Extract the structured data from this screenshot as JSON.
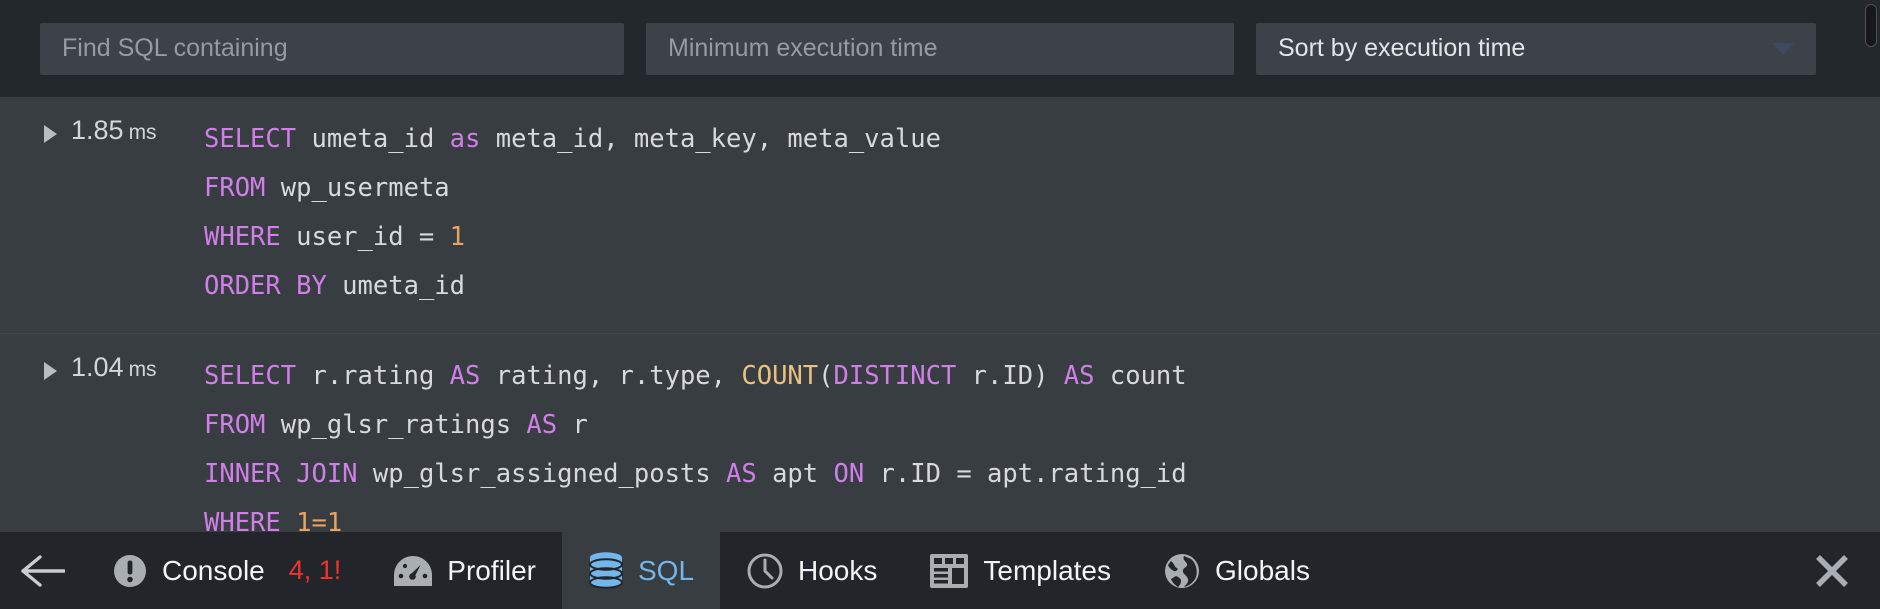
{
  "filters": {
    "find_placeholder": "Find SQL containing",
    "find_value": "",
    "min_time_placeholder": "Minimum execution time",
    "min_time_value": "",
    "sort_selected": "Sort by execution time",
    "sort_options": [
      "Sort by execution time"
    ]
  },
  "queries": [
    {
      "time": "1.85",
      "unit": "ms",
      "expanded": false,
      "lines": [
        [
          {
            "t": "SELECT",
            "c": "kw"
          },
          {
            "t": " umeta_id ",
            "c": "pl"
          },
          {
            "t": "as",
            "c": "kw"
          },
          {
            "t": " meta_id, meta_key, meta_value",
            "c": "pl"
          }
        ],
        [
          {
            "t": "FROM",
            "c": "kw"
          },
          {
            "t": " wp_usermeta",
            "c": "pl"
          }
        ],
        [
          {
            "t": "WHERE",
            "c": "kw"
          },
          {
            "t": " user_id = ",
            "c": "pl"
          },
          {
            "t": "1",
            "c": "num"
          }
        ],
        [
          {
            "t": "ORDER BY",
            "c": "kw"
          },
          {
            "t": " umeta_id",
            "c": "pl"
          }
        ]
      ]
    },
    {
      "time": "1.04",
      "unit": "ms",
      "expanded": false,
      "lines": [
        [
          {
            "t": "SELECT",
            "c": "kw"
          },
          {
            "t": " r.rating ",
            "c": "pl"
          },
          {
            "t": "AS",
            "c": "kw"
          },
          {
            "t": " rating, r.type, ",
            "c": "pl"
          },
          {
            "t": "COUNT",
            "c": "fn"
          },
          {
            "t": "(",
            "c": "pl"
          },
          {
            "t": "DISTINCT",
            "c": "kw"
          },
          {
            "t": " r.ID) ",
            "c": "pl"
          },
          {
            "t": "AS",
            "c": "kw"
          },
          {
            "t": " count",
            "c": "pl"
          }
        ],
        [
          {
            "t": "FROM",
            "c": "kw"
          },
          {
            "t": " wp_glsr_ratings ",
            "c": "pl"
          },
          {
            "t": "AS",
            "c": "kw"
          },
          {
            "t": " r",
            "c": "pl"
          }
        ],
        [
          {
            "t": "INNER JOIN",
            "c": "kw"
          },
          {
            "t": " wp_glsr_assigned_posts ",
            "c": "pl"
          },
          {
            "t": "AS",
            "c": "kw"
          },
          {
            "t": " apt ",
            "c": "pl"
          },
          {
            "t": "ON",
            "c": "kw"
          },
          {
            "t": " r.ID = apt.rating_id",
            "c": "pl"
          }
        ],
        [
          {
            "t": "WHERE",
            "c": "kw"
          },
          {
            "t": " ",
            "c": "pl"
          },
          {
            "t": "1=1",
            "c": "num"
          }
        ]
      ]
    }
  ],
  "toolbar": {
    "back_icon": "arrow-left-icon",
    "close_icon": "close-icon",
    "tabs": [
      {
        "id": "console",
        "label": "Console",
        "icon": "warning-icon",
        "badge": "4, 1!",
        "active": false
      },
      {
        "id": "profiler",
        "label": "Profiler",
        "icon": "gauge-icon",
        "badge": "",
        "active": false
      },
      {
        "id": "sql",
        "label": "SQL",
        "icon": "database-icon",
        "badge": "",
        "active": true
      },
      {
        "id": "hooks",
        "label": "Hooks",
        "icon": "clock-icon",
        "badge": "",
        "active": false
      },
      {
        "id": "templates",
        "label": "Templates",
        "icon": "template-icon",
        "badge": "",
        "active": false
      },
      {
        "id": "globals",
        "label": "Globals",
        "icon": "globe-icon",
        "badge": "",
        "active": false
      }
    ]
  },
  "colors": {
    "bg": "#383d42",
    "bar_bg": "#23282d",
    "toolbar_bg": "#22262b",
    "keyword": "#d17fe8",
    "function": "#eac17d",
    "number": "#e8a361",
    "plain": "#d7dadd",
    "accent": "#74b5ea",
    "badge": "#f0322a"
  }
}
